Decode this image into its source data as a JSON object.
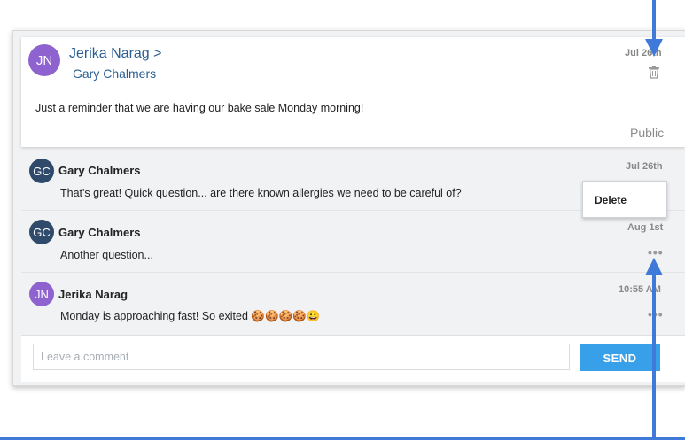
{
  "post": {
    "avatar_initials": "JN",
    "author": "Jerika Narag >",
    "recipient": "Gary Chalmers",
    "date": "Jul 26th",
    "text": "Just a reminder that we are having our bake sale Monday morning!",
    "visibility": "Public",
    "delete_icon": "trash-icon"
  },
  "comments": [
    {
      "avatar_initials": "GC",
      "avatar_color": "#2f4a6b",
      "name": "Gary Chalmers",
      "text": "That's great! Quick question... are there known allergies we need to be careful of?",
      "date": "Jul 26th"
    },
    {
      "avatar_initials": "GC",
      "avatar_color": "#2f4a6b",
      "name": "Gary Chalmers",
      "text": "Another question...",
      "date": "Aug 1st",
      "menu": "•••"
    },
    {
      "avatar_initials": "JN",
      "avatar_color": "#8e62cf",
      "name": "Jerika Narag",
      "text": "Monday is approaching fast! So exited 🍪🍪🍪🍪😀",
      "date": "10:55 AM",
      "menu": "•••"
    }
  ],
  "popup": {
    "delete_label": "Delete"
  },
  "composer": {
    "placeholder": "Leave a comment",
    "send_label": "SEND"
  },
  "colors": {
    "accent": "#38a0e8",
    "link": "#2a5e93",
    "annotation_arrow": "#3f7ad8"
  }
}
